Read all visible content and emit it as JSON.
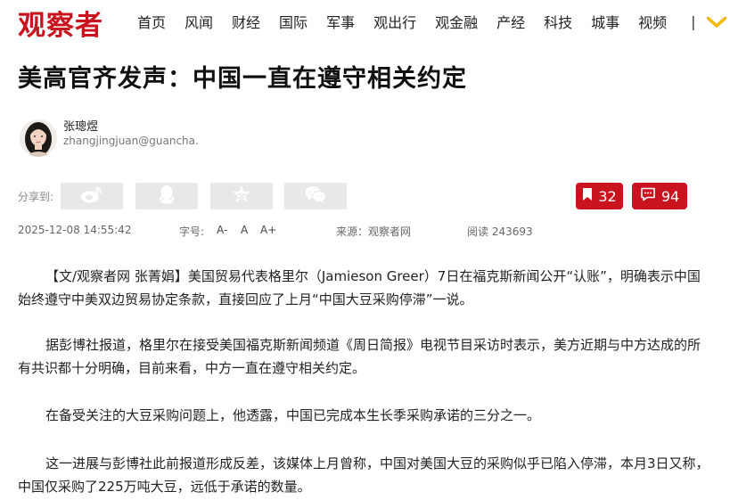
{
  "site": {
    "logo": "观察者"
  },
  "nav": {
    "items": [
      "首页",
      "风闻",
      "财经",
      "国际",
      "军事",
      "观出行",
      "观金融",
      "产经",
      "科技",
      "城事",
      "视频"
    ],
    "separator": "|",
    "accent_color": "#f5b800"
  },
  "article": {
    "title": "美高官齐发声：中国一直在遵守相关约定",
    "author": {
      "name": "张璁煜",
      "email": "zhangjingjuan@guancha.c"
    },
    "share": {
      "label": "分享到:",
      "buttons": [
        "weibo-icon",
        "qq-icon",
        "qzone-star-icon",
        "wechat-icon"
      ]
    },
    "bookmark_count": "32",
    "comment_count": "94",
    "brand_color": "#c9141f",
    "meta": {
      "datetime": "2025-12-08 14:55:42",
      "font_label": "字号:",
      "font_decrease": "A-",
      "font_normal": "A",
      "font_increase": "A+",
      "source": "来源：观察者网",
      "views": "阅读 243693"
    },
    "paragraphs": [
      "【文/观察者网 张菁娟】美国贸易代表格里尔（Jamieson Greer）7日在福克斯新闻公开“认账”，明确表示中国始终遵守中美双边贸易协定条款，直接回应了上月“中国大豆采购停滞”一说。",
      "据彭博社报道，格里尔在接受美国福克斯新闻频道《周日简报》电视节目采访时表示，美方近期与中方达成的所有共识都十分明确，目前来看，中方一直在遵守相关约定。",
      "在备受关注的大豆采购问题上，他透露，中国已完成本生长季采购承诺的三分之一。",
      "这一进展与彭博社此前报道形成反差，该媒体上月曾称，中国对美国大豆的采购似乎已陷入停滞，本月3日又称，中国仅采购了225万吨大豆，远低于承诺的数量。"
    ]
  }
}
